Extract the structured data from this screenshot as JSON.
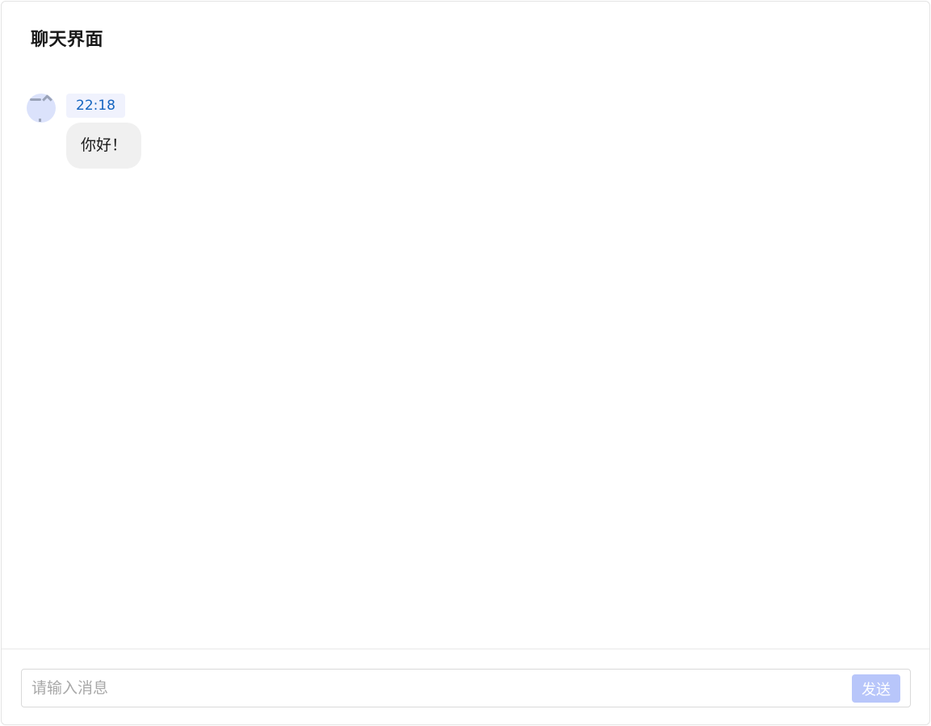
{
  "header": {
    "title": "聊天界面"
  },
  "messages": [
    {
      "avatar_icon": "user-avatar-icon",
      "time": "22:18",
      "text": "你好！"
    }
  ],
  "composer": {
    "placeholder": "请输入消息",
    "value": "",
    "send_label": "发送"
  },
  "colors": {
    "timestamp_text": "#1565c0",
    "timestamp_bg": "#f0f2fd",
    "bubble_bg": "#f0f0f0",
    "send_button_bg": "#b8c6fa",
    "avatar_bg": "#dbe2fb"
  }
}
